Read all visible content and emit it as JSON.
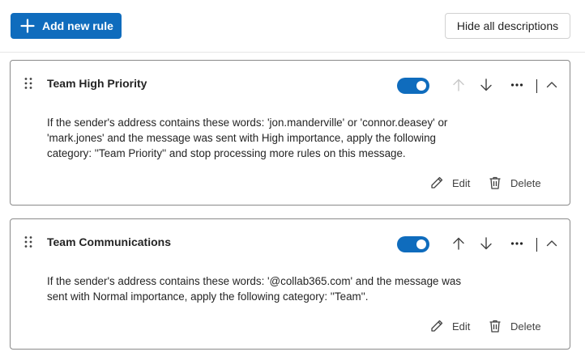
{
  "toolbar": {
    "add_label": "Add new rule",
    "hide_label": "Hide all descriptions"
  },
  "rules": [
    {
      "title": "Team High Priority",
      "enabled": true,
      "description_lines": [
        "If the sender's address contains these words: 'jon.manderville' or 'connor.deasey' or",
        "'mark.jones' and the message was sent with High importance, apply the following",
        "category: ''Team Priority'' and stop processing more rules on this message."
      ],
      "edit_label": "Edit",
      "delete_label": "Delete"
    },
    {
      "title": "Team Communications",
      "enabled": true,
      "description_lines": [
        "If the sender's address contains these words: '@collab365.com' and the message was",
        "sent with Normal importance, apply the following category: ''Team''."
      ],
      "edit_label": "Edit",
      "delete_label": "Delete"
    }
  ],
  "colors": {
    "accent": "#0f6cbd",
    "disabled_arrow": "#c8c8c8"
  }
}
